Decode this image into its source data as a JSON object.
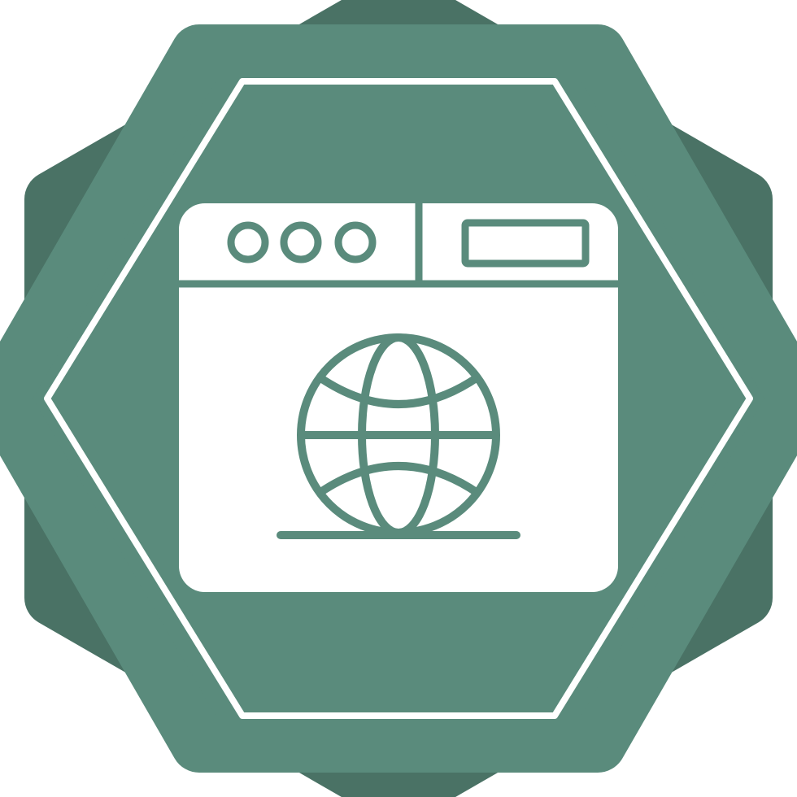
{
  "icon": {
    "name": "web-browser-globe-icon",
    "badge_shape": "hexagonal-starburst",
    "glyph": "browser-window-with-globe"
  },
  "colors": {
    "background": "#ffffff",
    "badge_back": "#4a7265",
    "badge_front": "#5a8b7c",
    "outline": "#ffffff",
    "glyph_fill": "#ffffff",
    "glyph_detail": "#5a8b7c"
  }
}
